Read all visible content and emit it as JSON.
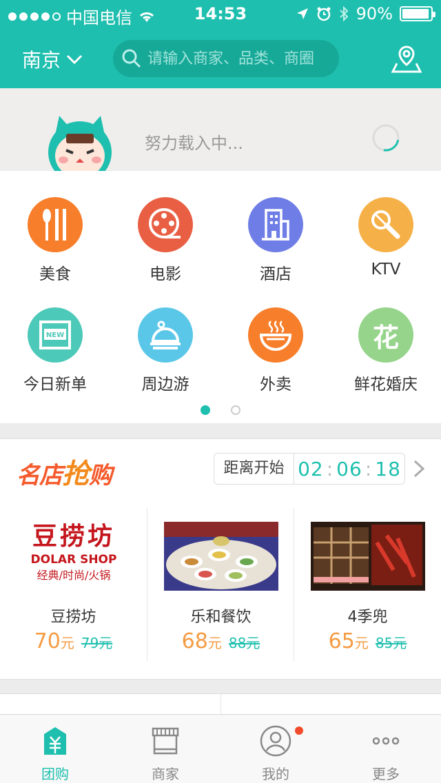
{
  "status_bar": {
    "carrier": "中国电信",
    "time": "14:53",
    "battery": "90%",
    "signal_dots": 5,
    "signal_filled": 4
  },
  "header": {
    "city": "南京",
    "search_placeholder": "请输入商家、品类、商圈"
  },
  "loader": {
    "text": "努力载入中..."
  },
  "categories": [
    {
      "label": "美食",
      "color": "#f77e2a",
      "icon": "fork-spoon-icon"
    },
    {
      "label": "电影",
      "color": "#e95f44",
      "icon": "film-reel-icon"
    },
    {
      "label": "酒店",
      "color": "#6f7ee6",
      "icon": "building-icon"
    },
    {
      "label": "KTV",
      "color": "#f5b148",
      "icon": "microphone-icon"
    },
    {
      "label": "今日新单",
      "color": "#4cc9b8",
      "icon": "new-tag-icon"
    },
    {
      "label": "周边游",
      "color": "#5bc7e8",
      "icon": "travel-bag-icon"
    },
    {
      "label": "外卖",
      "color": "#f77e2a",
      "icon": "bowl-icon"
    },
    {
      "label": "鲜花婚庆",
      "color": "#95d48a",
      "icon": "flower-icon",
      "glyph": "花"
    }
  ],
  "pager": {
    "pages": 2,
    "current": 1
  },
  "flash_sale": {
    "title_a": "名店",
    "title_b": "抢",
    "title_c": "购",
    "countdown_label": "距离开始",
    "hours": "02",
    "minutes": "06",
    "seconds": "18",
    "deals": [
      {
        "name": "豆捞坊",
        "price": "70",
        "unit": "元",
        "old_price": "79元",
        "logo_title": "豆捞坊",
        "logo_sub": "DOLAR SHOP",
        "logo_tag": "经典/时尚/火锅"
      },
      {
        "name": "乐和餐饮",
        "price": "68",
        "unit": "元",
        "old_price": "88元"
      },
      {
        "name": "4季兜",
        "price": "65",
        "unit": "元",
        "old_price": "85元"
      }
    ]
  },
  "tabs": [
    {
      "label": "团购",
      "icon": "group-buy-icon",
      "active": true
    },
    {
      "label": "商家",
      "icon": "store-icon",
      "active": false
    },
    {
      "label": "我的",
      "icon": "user-icon",
      "active": false
    },
    {
      "label": "更多",
      "icon": "more-icon",
      "active": false
    }
  ],
  "colors": {
    "accent": "#1ebfae",
    "price": "#f59b42",
    "badge": "#f04c2c"
  }
}
